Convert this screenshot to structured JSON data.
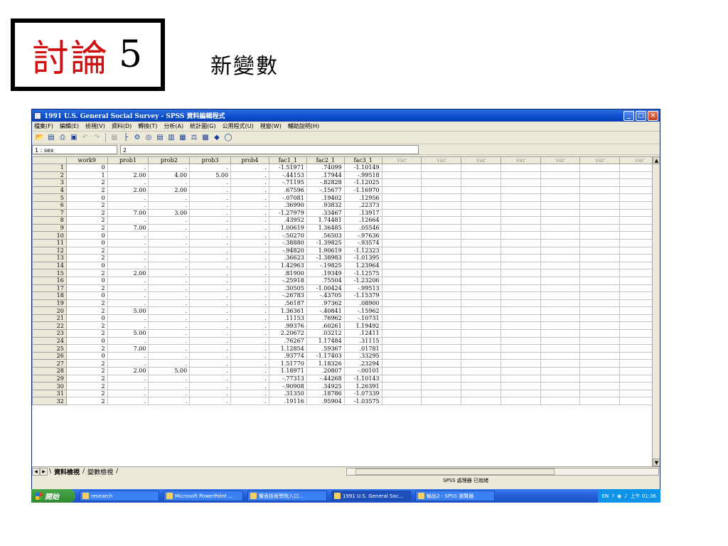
{
  "slide": {
    "title_red": "討論",
    "title_num": "5",
    "subtitle": "新變數"
  },
  "window": {
    "title": "1991 U.S. General Social Survey - SPSS 資料編輯程式",
    "controls": {
      "minimize": "_",
      "maximize": "□",
      "close": "×"
    }
  },
  "menu": [
    "檔案(F)",
    "編輯(E)",
    "檢視(V)",
    "資料(D)",
    "轉換(T)",
    "分析(A)",
    "統計圖(G)",
    "公用程式(U)",
    "視窗(W)",
    "輔助說明(H)"
  ],
  "cell_editor": {
    "name": "1 : sex",
    "value": "2"
  },
  "columns": [
    "work9",
    "prob1",
    "prob2",
    "prob3",
    "prob4",
    "fac1_1",
    "fac2_1",
    "fac3_1",
    "var",
    "var",
    "var",
    "var",
    "var",
    "var",
    "var"
  ],
  "rows": [
    [
      "1",
      "0",
      ".",
      ".",
      ".",
      ".",
      "-1.51971",
      ".74099",
      "-1.10149"
    ],
    [
      "2",
      "1",
      "2.00",
      "4.00",
      "5.00",
      ".",
      "-.44153",
      ".17944",
      "-.99518"
    ],
    [
      "3",
      "2",
      ".",
      ".",
      ".",
      ".",
      "-.71195",
      "-.82828",
      "-1.12025"
    ],
    [
      "4",
      "2",
      "2.00",
      "2.00",
      ".",
      ".",
      ".67596",
      "-.15677",
      "-1.16970"
    ],
    [
      "5",
      "0",
      ".",
      ".",
      ".",
      ".",
      "-.07081",
      ".19402",
      ".12956"
    ],
    [
      "6",
      "2",
      ".",
      ".",
      ".",
      ".",
      ".36990",
      ".93832",
      ".22373"
    ],
    [
      "7",
      "2",
      "7.00",
      "3.00",
      ".",
      ".",
      "-1.27979",
      ".33467",
      ".13917"
    ],
    [
      "8",
      "2",
      ".",
      ".",
      ".",
      ".",
      ".43952",
      "1.74481",
      ".12664"
    ],
    [
      "9",
      "2",
      "7.00",
      ".",
      ".",
      ".",
      "1.00619",
      "1.36485",
      ".05546"
    ],
    [
      "10",
      "0",
      ".",
      ".",
      ".",
      ".",
      "-.50270",
      ".56503",
      "-.97636"
    ],
    [
      "11",
      "0",
      ".",
      ".",
      ".",
      ".",
      "-.38880",
      "-1.39825",
      "-.93574"
    ],
    [
      "12",
      "2",
      ".",
      ".",
      ".",
      ".",
      "-.94820",
      "1.90619",
      "-1.12323"
    ],
    [
      "13",
      "2",
      ".",
      ".",
      ".",
      ".",
      ".36623",
      "-1.38983",
      "-1.01395"
    ],
    [
      "14",
      "0",
      ".",
      ".",
      ".",
      ".",
      "1.42963",
      "-.19825",
      "1.23964"
    ],
    [
      "15",
      "2",
      "2.00",
      ".",
      ".",
      ".",
      ".81900",
      ".19349",
      "-1.12575"
    ],
    [
      "16",
      "0",
      ".",
      ".",
      ".",
      ".",
      "-.25918",
      ".75504",
      "-1.23206"
    ],
    [
      "17",
      "2",
      ".",
      ".",
      ".",
      ".",
      ".30505",
      "-1.00424",
      "-.99513"
    ],
    [
      "18",
      "0",
      ".",
      ".",
      ".",
      ".",
      "-.26783",
      "-.43705",
      "-1.15379"
    ],
    [
      "19",
      "2",
      ".",
      ".",
      ".",
      ".",
      ".56187",
      ".97362",
      ".08900"
    ],
    [
      "20",
      "2",
      "5.00",
      ".",
      ".",
      ".",
      "1.36361",
      "-.40841",
      "-.15962"
    ],
    [
      "21",
      "0",
      ".",
      ".",
      ".",
      ".",
      ".11153",
      ".76962",
      "-.10731"
    ],
    [
      "22",
      "2",
      ".",
      ".",
      ".",
      ".",
      ".99376",
      ".60261",
      "1.19492"
    ],
    [
      "23",
      "2",
      "5.00",
      ".",
      ".",
      ".",
      "2.20672",
      ".03212",
      ".12411"
    ],
    [
      "24",
      "0",
      ".",
      ".",
      ".",
      ".",
      ".76267",
      "1.17484",
      ".31115"
    ],
    [
      "25",
      "2",
      "7.00",
      ".",
      ".",
      ".",
      "1.12854",
      ".59367",
      ".01781"
    ],
    [
      "26",
      "0",
      ".",
      ".",
      ".",
      ".",
      ".93774",
      "-1.17403",
      ".33295"
    ],
    [
      "27",
      "2",
      ".",
      ".",
      ".",
      ".",
      "1.51770",
      "1.18326",
      ".23294"
    ],
    [
      "28",
      "2",
      "2.00",
      "5.00",
      ".",
      ".",
      "1.18971",
      ".20807",
      "-.00101"
    ],
    [
      "29",
      "2",
      ".",
      ".",
      ".",
      ".",
      "-.77313",
      "-.44268",
      "-1.10143"
    ],
    [
      "30",
      "2",
      ".",
      ".",
      ".",
      ".",
      "-.90908",
      ".34925",
      "1.26391"
    ],
    [
      "31",
      "2",
      ".",
      ".",
      ".",
      ".",
      ".31350",
      ".18786",
      "-1.07339"
    ],
    [
      "32",
      "2",
      ".",
      ".",
      ".",
      ".",
      ".19116",
      ".95904",
      "-1.03575"
    ]
  ],
  "tabs": {
    "data_view": "資料檢視",
    "variable_view": "變數檢視"
  },
  "status": "SPSS 處理器 已就緒",
  "taskbar": {
    "start": "開始",
    "items": [
      "research",
      "Microsoft PowerPoint ...",
      "醫香技術學院入口...",
      "1991 U.S. General Soc...",
      "輸出2 - SPSS 瀏覽器"
    ],
    "tray_lang": "EN",
    "clock": "上午 01:36"
  }
}
